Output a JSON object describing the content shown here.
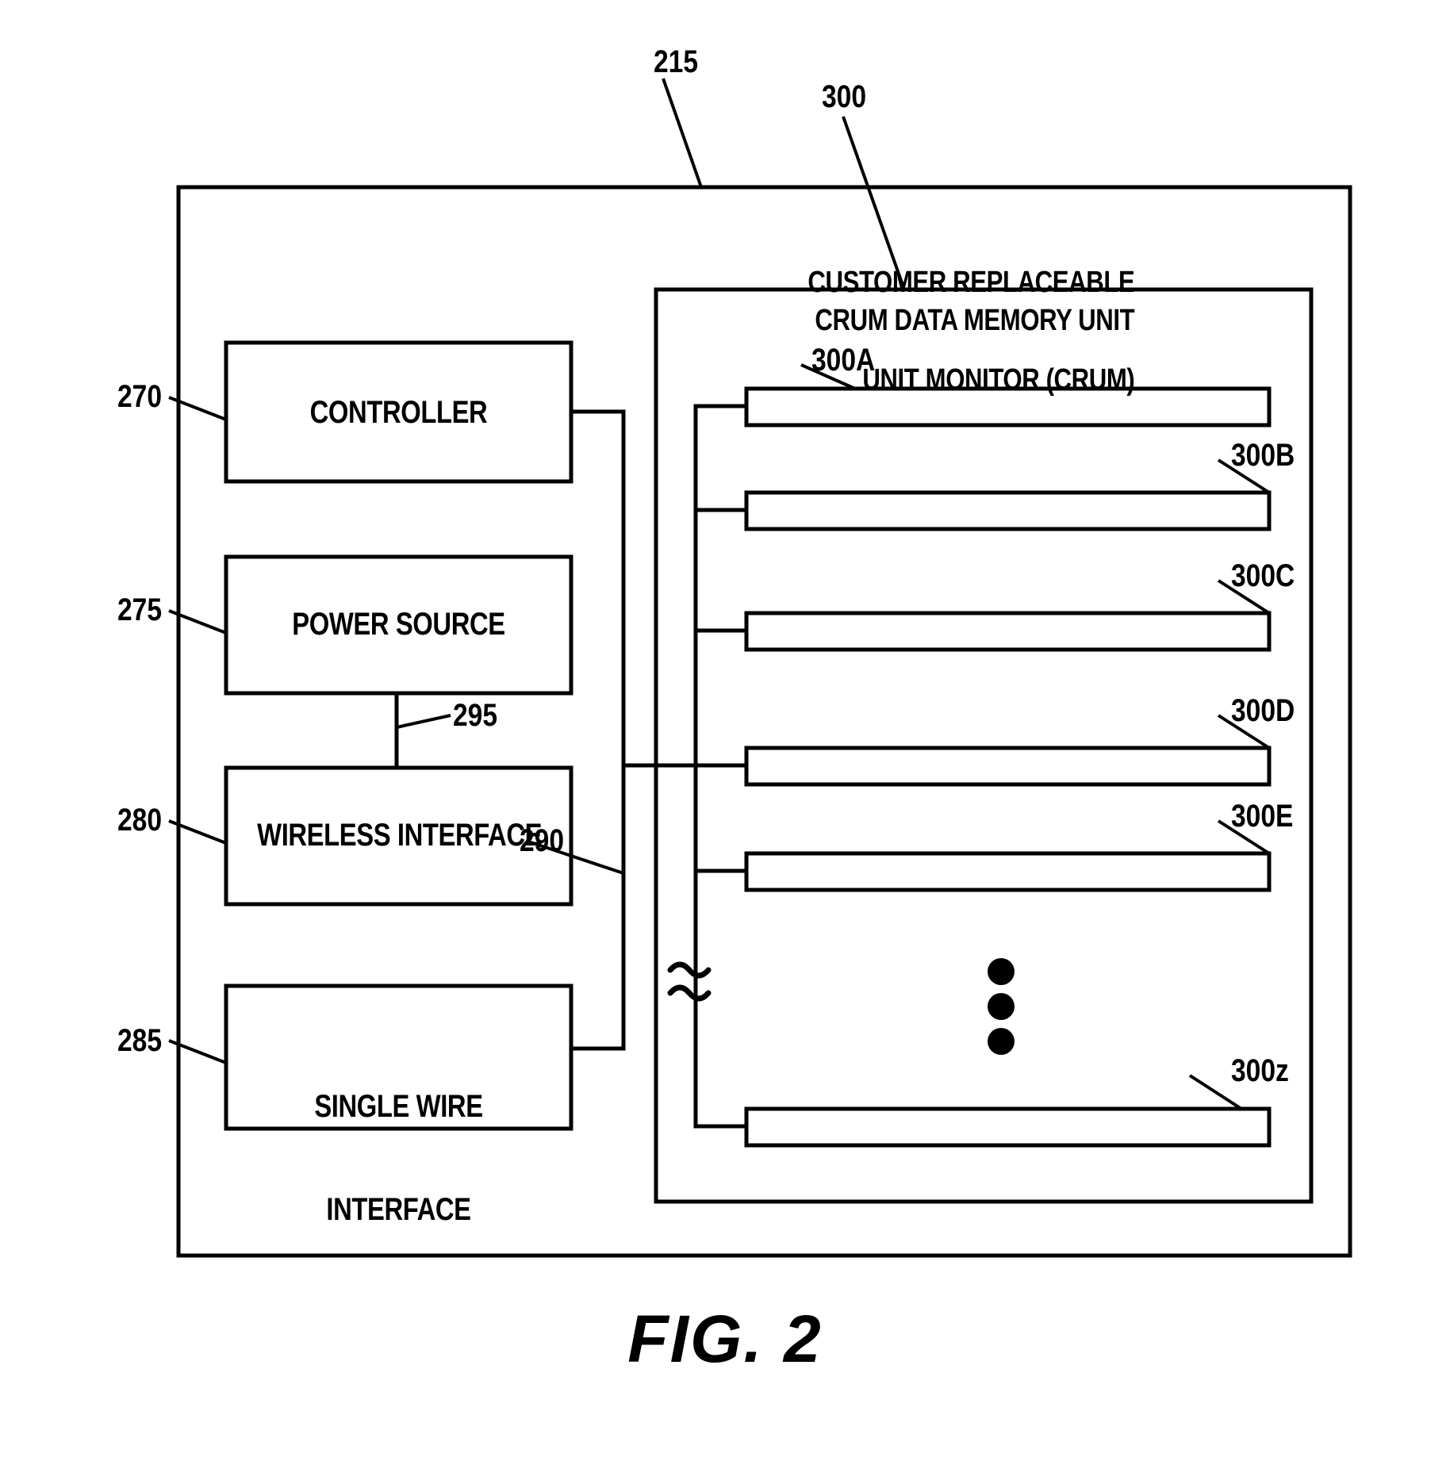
{
  "figure": {
    "caption": "FIG. 2",
    "outer_unit_ref": "215",
    "crum_title_line1": "CUSTOMER REPLACEABLE",
    "crum_title_line2": "UNIT MONITOR (CRUM)",
    "memory_unit_ref": "300",
    "memory_unit_title": "CRUM DATA MEMORY UNIT",
    "bus_ref": "290",
    "power_link_ref": "295"
  },
  "blocks": [
    {
      "ref": "270",
      "label": "CONTROLLER"
    },
    {
      "ref": "275",
      "label": "POWER SOURCE"
    },
    {
      "ref": "280",
      "label": "WIRELESS INTERFACE"
    },
    {
      "ref": "285",
      "label_line1": "SINGLE WIRE",
      "label_line2": "INTERFACE"
    }
  ],
  "memory_bars": [
    {
      "ref": "300A"
    },
    {
      "ref": "300B"
    },
    {
      "ref": "300C"
    },
    {
      "ref": "300D"
    },
    {
      "ref": "300E"
    },
    {
      "ref": "300z"
    }
  ],
  "ellipsis": {
    "dots": 3
  },
  "colors": {
    "line": "#000000",
    "background": "#ffffff"
  }
}
